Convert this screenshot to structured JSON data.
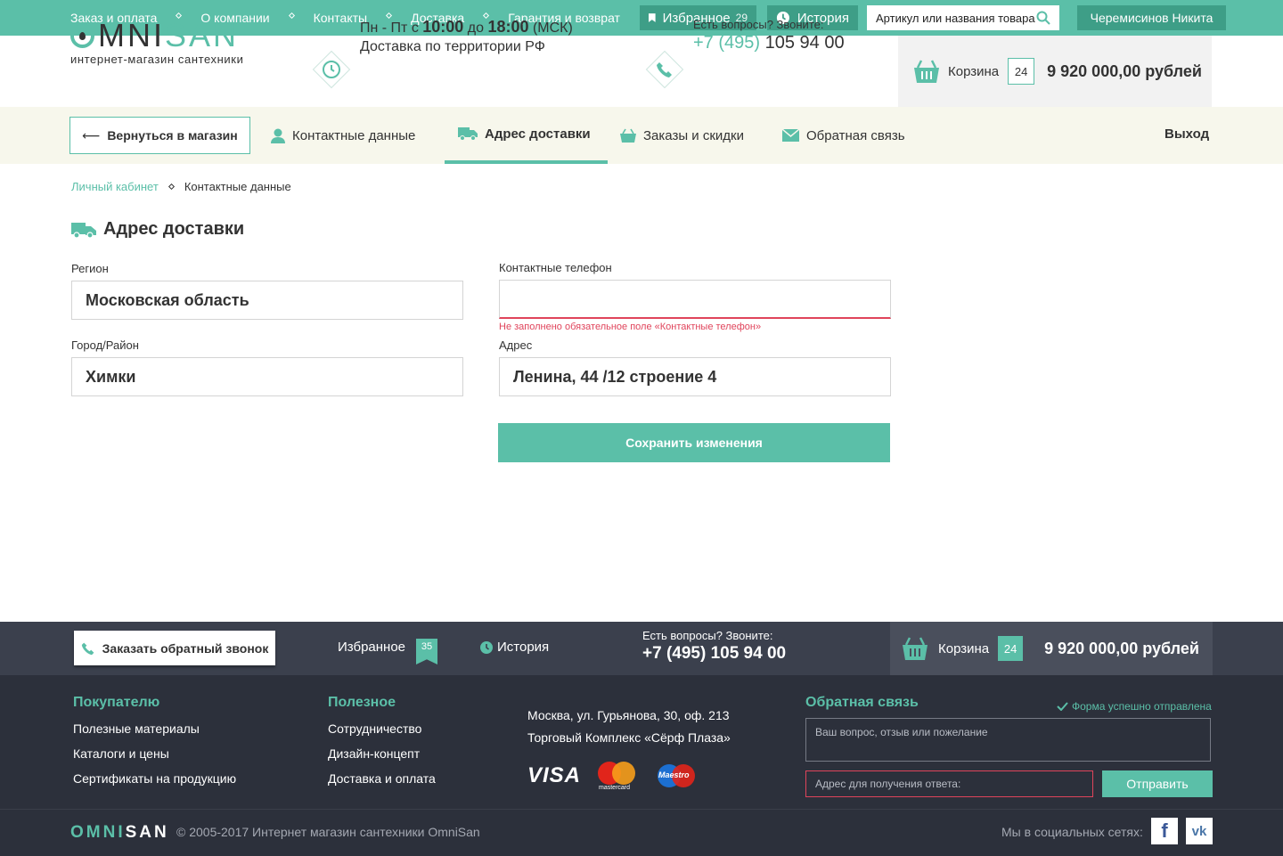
{
  "topbar": {
    "nav": [
      "Заказ и оплата",
      "О компании",
      "Контакты",
      "Доставка",
      "Гарантия и возврат"
    ],
    "favorites_label": "Избранное",
    "favorites_count": "29",
    "history_label": "История",
    "search_placeholder": "Артикул или названия товара",
    "user_name": "Черемисинов Никита"
  },
  "header": {
    "logo_o": "O",
    "logo_mni": "MNI",
    "logo_san": "SAN",
    "logo_sub": "интернет-магазин сантехники",
    "hours_pre": "Пн - Пт с",
    "hours_from": "10:00",
    "hours_mid": "до",
    "hours_to": "18:00",
    "hours_tz": "(МСК)",
    "delivery_note": "Доставка по территории РФ",
    "phone_q": "Есть вопросы? Звоните:",
    "phone_code": "+7 (495)",
    "phone_num": "105 94 00",
    "cart_label": "Корзина",
    "cart_count": "24",
    "cart_sum": "9 920 000,00 рублей"
  },
  "subnav": {
    "back": "Вернуться в магазин",
    "contact": "Контактные данные",
    "address": "Адрес доставки",
    "orders": "Заказы и скидки",
    "feedback": "Обратная связь",
    "exit": "Выход"
  },
  "breadcrumb": [
    "Личный кабинет",
    "Контактные данные"
  ],
  "page_title": "Адрес доставки",
  "form": {
    "region_label": "Регион",
    "region_value": "Московская область",
    "city_label": "Город/Район",
    "city_value": "Химки",
    "phone_label": "Контактные телефон",
    "phone_value": "",
    "phone_error": "Не заполнено обязательное поле «Контактные телефон»",
    "address_label": "Адрес",
    "address_value": "Ленина, 44 /12 строение 4",
    "save": "Сохранить изменения"
  },
  "footer_bar": {
    "callback": "Заказать обратный звонок",
    "favorites": "Избранное",
    "favorites_count": "35",
    "history": "История",
    "phone_q": "Есть вопросы? Звоните:",
    "phone": "+7 (495) 105 94 00",
    "cart_label": "Корзина",
    "cart_count": "24",
    "cart_sum": "9 920 000,00 рублей"
  },
  "footer": {
    "col1_title": "Покупателю",
    "col1": [
      "Полезные материалы",
      "Каталоги и цены",
      "Сертификаты на продукцию"
    ],
    "col2_title": "Полезное",
    "col2": [
      "Сотрудничество",
      "Дизайн-концепт",
      "Доставка и оплата"
    ],
    "address1": "Москва, ул. Гурьянова, 30, оф. 213",
    "address2": "Торговый Комплекс «Сёрф Плаза»",
    "pay_visa": "VISA",
    "pay_mastercard": "mastercard",
    "pay_maestro": "Maestro",
    "feedback_title": "Обратная связь",
    "feedback_ok": "Форма успешно отправлена",
    "feedback_placeholder": "Ваш вопрос, отзыв или пожелание",
    "email_placeholder": "Адрес для получения ответа:",
    "send": "Отправить"
  },
  "bottom": {
    "logo_omni": "OMNI",
    "logo_san": "SAN",
    "copyright": "© 2005-2017 Интернет магазин сантехники OmniSan",
    "social_label": "Мы в социальных сетях:",
    "fb": "f",
    "vk": "vk"
  },
  "colors": {
    "accent": "#5bbfa8",
    "accent_dark": "#3e9e87",
    "error": "#e0445b",
    "footer_bg": "#2c303b"
  }
}
